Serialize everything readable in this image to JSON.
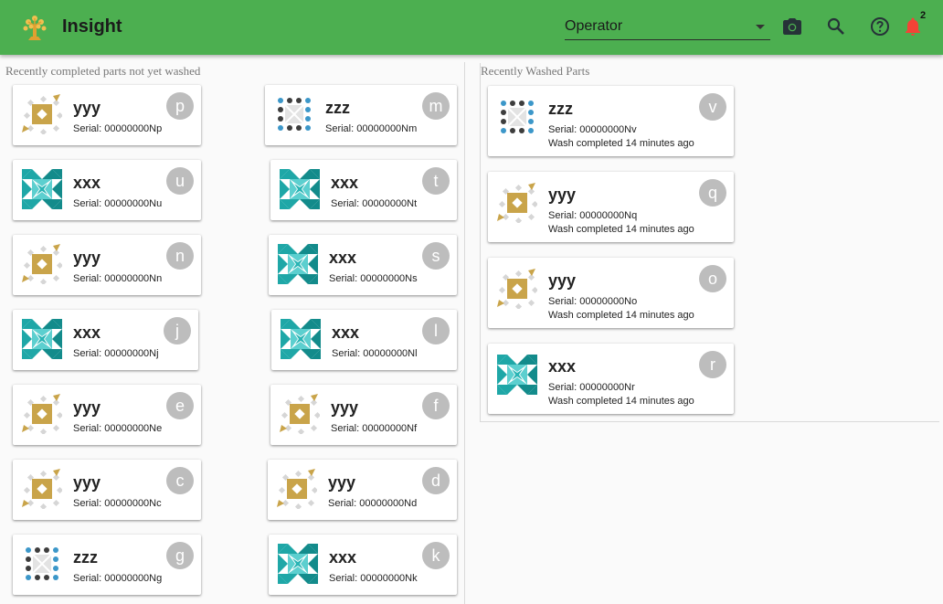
{
  "app": {
    "title": "Insight"
  },
  "toolbar": {
    "role_value": "Operator",
    "notification_count": "2",
    "icons": [
      "camera-icon",
      "search-icon",
      "help-icon",
      "bell-icon"
    ]
  },
  "columns": {
    "unwashed_label": "Recently completed parts not yet washed",
    "washed_label": "Recently Washed Parts"
  },
  "unwashed": [
    {
      "name": "yyy",
      "serial": "Serial: 00000000Np",
      "letter": "p",
      "kind": "yyy"
    },
    {
      "name": "zzz",
      "serial": "Serial: 00000000Nm",
      "letter": "m",
      "kind": "zzz"
    },
    {
      "name": "xxx",
      "serial": "Serial: 00000000Nu",
      "letter": "u",
      "kind": "xxx"
    },
    {
      "name": "xxx",
      "serial": "Serial: 00000000Nt",
      "letter": "t",
      "kind": "xxx"
    },
    {
      "name": "yyy",
      "serial": "Serial: 00000000Nn",
      "letter": "n",
      "kind": "yyy"
    },
    {
      "name": "xxx",
      "serial": "Serial: 00000000Ns",
      "letter": "s",
      "kind": "xxx"
    },
    {
      "name": "xxx",
      "serial": "Serial: 00000000Nj",
      "letter": "j",
      "kind": "xxx"
    },
    {
      "name": "xxx",
      "serial": "Serial: 00000000Nl",
      "letter": "l",
      "kind": "xxx"
    },
    {
      "name": "yyy",
      "serial": "Serial: 00000000Ne",
      "letter": "e",
      "kind": "yyy"
    },
    {
      "name": "yyy",
      "serial": "Serial: 00000000Nf",
      "letter": "f",
      "kind": "yyy"
    },
    {
      "name": "yyy",
      "serial": "Serial: 00000000Nc",
      "letter": "c",
      "kind": "yyy"
    },
    {
      "name": "yyy",
      "serial": "Serial: 00000000Nd",
      "letter": "d",
      "kind": "yyy"
    },
    {
      "name": "zzz",
      "serial": "Serial: 00000000Ng",
      "letter": "g",
      "kind": "zzz"
    },
    {
      "name": "xxx",
      "serial": "Serial: 00000000Nk",
      "letter": "k",
      "kind": "xxx"
    }
  ],
  "washed": [
    {
      "name": "zzz",
      "serial": "Serial: 00000000Nv",
      "wash": "Wash completed 14 minutes ago",
      "letter": "v",
      "kind": "zzz"
    },
    {
      "name": "yyy",
      "serial": "Serial: 00000000Nq",
      "wash": "Wash completed 14 minutes ago",
      "letter": "q",
      "kind": "yyy"
    },
    {
      "name": "yyy",
      "serial": "Serial: 00000000No",
      "wash": "Wash completed 14 minutes ago",
      "letter": "o",
      "kind": "yyy"
    },
    {
      "name": "xxx",
      "serial": "Serial: 00000000Nr",
      "wash": "Wash completed 14 minutes ago",
      "letter": "r",
      "kind": "xxx"
    }
  ],
  "colors": {
    "appbar": "#4caf50",
    "notification": "#f44336",
    "letter_avatar": "#bdbdbd"
  }
}
